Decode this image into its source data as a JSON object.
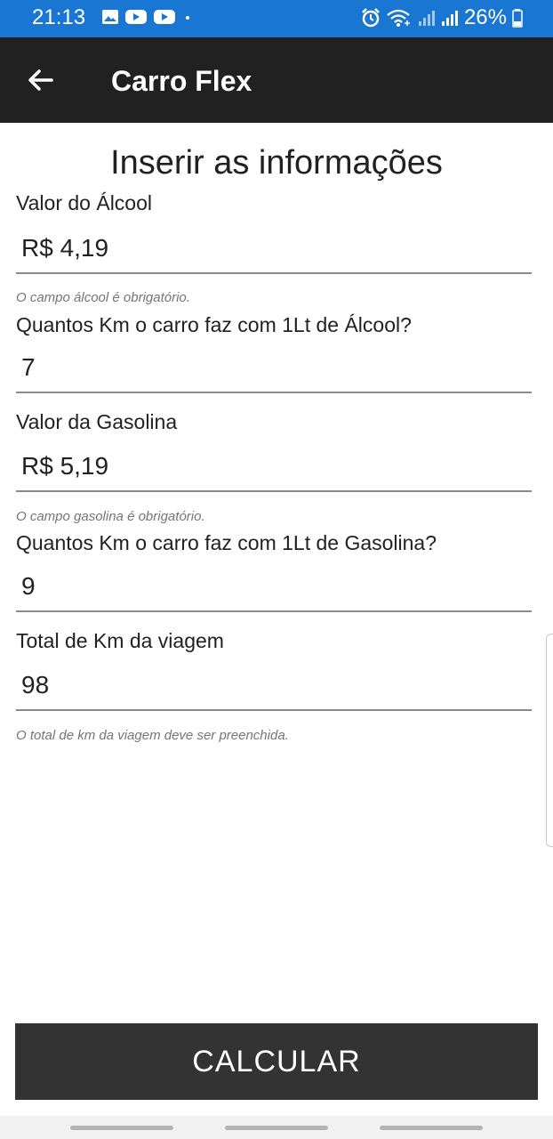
{
  "status_bar": {
    "time": "21:13",
    "battery": "26%",
    "color": "#1976d2",
    "icons_left": [
      "gallery-icon",
      "youtube-icon",
      "youtube-icon",
      "dot-icon"
    ],
    "icons_right": [
      "alarm-icon",
      "wifi-icon",
      "signal-icon",
      "signal-icon",
      "battery-icon"
    ]
  },
  "app_bar": {
    "title": "Carro Flex",
    "back_icon": "arrow-left-icon",
    "color": "#212121"
  },
  "form": {
    "heading": "Inserir as informações",
    "fields": [
      {
        "label": "Valor do Álcool",
        "value": "R$ 4,19",
        "hint": "O campo álcool é obrigatório."
      },
      {
        "label": "Quantos Km o carro faz com 1Lt de Álcool?",
        "value": "7",
        "hint": ""
      },
      {
        "label": "Valor da Gasolina",
        "value": "R$ 5,19",
        "hint": "O campo gasolina é obrigatório."
      },
      {
        "label": "Quantos Km o carro faz com 1Lt de Gasolina?",
        "value": "9",
        "hint": ""
      },
      {
        "label": "Total de Km da viagem",
        "value": "98",
        "hint": "O total de km da viagem deve ser preenchida."
      }
    ]
  },
  "button": {
    "label": "CALCULAR",
    "color": "#333333"
  }
}
